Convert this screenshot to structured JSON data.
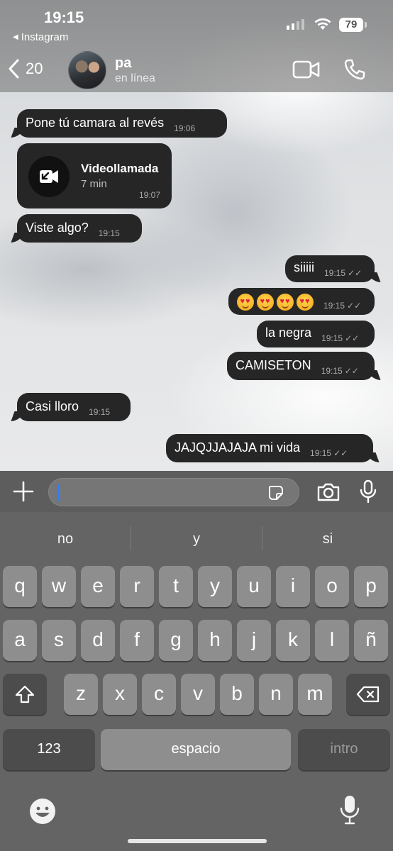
{
  "status_bar": {
    "time": "19:15",
    "back_app": "Instagram",
    "battery": "79"
  },
  "header": {
    "unread_count": "20",
    "contact_name": "pa",
    "contact_status": "en línea"
  },
  "messages": [
    {
      "dir": "in",
      "text": "Pone tú camara al revés",
      "time": "19:06"
    },
    {
      "dir": "in",
      "type": "call",
      "title": "Videollamada",
      "duration": "7 min",
      "time": "19:07"
    },
    {
      "dir": "in",
      "text": "Viste algo?",
      "time": "19:15"
    },
    {
      "dir": "out",
      "text": "siiiii",
      "time": "19:15",
      "read": true
    },
    {
      "dir": "out",
      "type": "emoji",
      "count": 4,
      "emoji_name": "heart-eyes-emoji",
      "time": "19:15",
      "read": true
    },
    {
      "dir": "out",
      "text": "la negra",
      "time": "19:15",
      "read": true
    },
    {
      "dir": "out",
      "text": "CAMISETON",
      "time": "19:15",
      "read": true
    },
    {
      "dir": "in",
      "text": "Casi lloro",
      "time": "19:15"
    },
    {
      "dir": "out",
      "text": "JAJQJJAJAJA mi vida",
      "time": "19:15",
      "read": true
    }
  ],
  "composer": {
    "value": "",
    "placeholder": ""
  },
  "keyboard": {
    "suggestions": [
      "no",
      "y",
      "si"
    ],
    "row1": [
      "q",
      "w",
      "e",
      "r",
      "t",
      "y",
      "u",
      "i",
      "o",
      "p"
    ],
    "row2": [
      "a",
      "s",
      "d",
      "f",
      "g",
      "h",
      "j",
      "k",
      "l",
      "ñ"
    ],
    "row3": [
      "z",
      "x",
      "c",
      "v",
      "b",
      "n",
      "m"
    ],
    "numbers_label": "123",
    "space_label": "espacio",
    "return_label": "intro"
  },
  "colors": {
    "bubble": "#262626",
    "keyboard": "#646464",
    "key": "#8e8e8e",
    "cursor": "#2f7cf6"
  }
}
